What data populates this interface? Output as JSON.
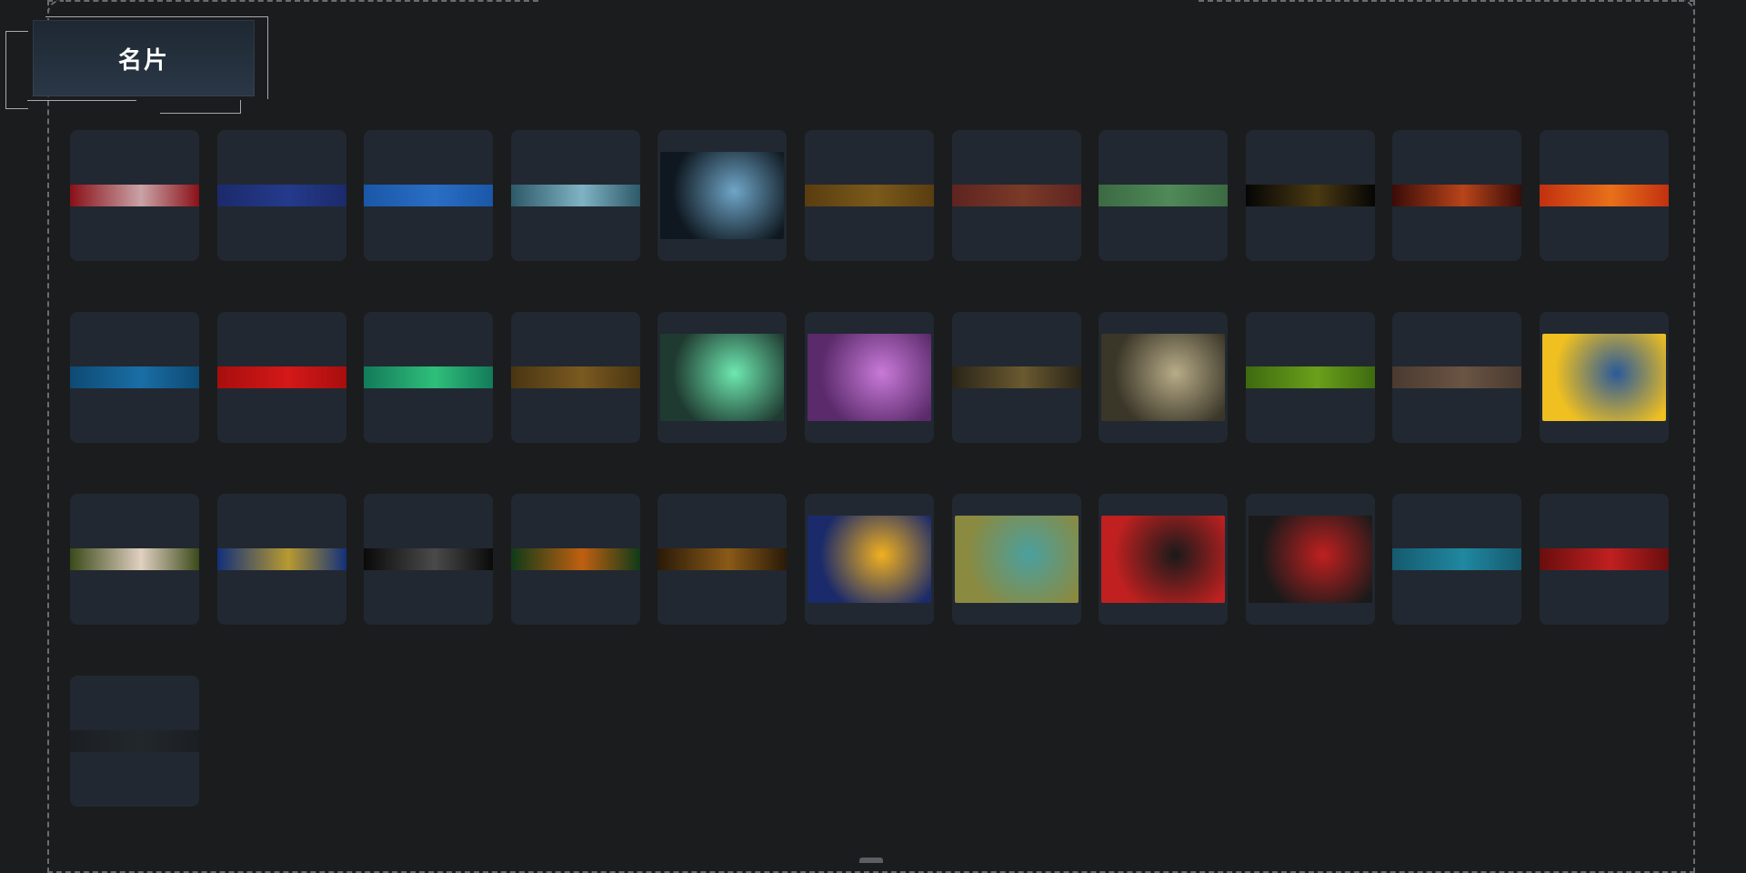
{
  "title": "名片",
  "cards": [
    {
      "kind": "strip",
      "color": "#8a1018",
      "color2": "#c9a3a6"
    },
    {
      "kind": "strip",
      "color": "#1c2a6b",
      "color2": "#243a8c"
    },
    {
      "kind": "strip",
      "color": "#1a57a8",
      "color2": "#2a6ec4"
    },
    {
      "kind": "strip",
      "color": "#2d5968",
      "color2": "#7fb3c4"
    },
    {
      "kind": "image",
      "color": "#0f1820",
      "color2": "#6fa6c8",
      "icon": "car-image"
    },
    {
      "kind": "strip",
      "color": "#5a3d10",
      "color2": "#7a5a1a"
    },
    {
      "kind": "strip",
      "color": "#5e2420",
      "color2": "#7a3a28"
    },
    {
      "kind": "strip",
      "color": "#3b6a42",
      "color2": "#4f8a58"
    },
    {
      "kind": "strip",
      "color": "#050505",
      "color2": "#4a3a12"
    },
    {
      "kind": "strip",
      "color": "#3a0c08",
      "color2": "#b8441a"
    },
    {
      "kind": "strip",
      "color": "#c23010",
      "color2": "#e8701a"
    },
    {
      "kind": "strip",
      "color": "#0e4a73",
      "color2": "#1a6ea6"
    },
    {
      "kind": "strip",
      "color": "#a80e0e",
      "color2": "#d41818"
    },
    {
      "kind": "strip",
      "color": "#137a5a",
      "color2": "#2fbf7a"
    },
    {
      "kind": "strip",
      "color": "#4a3512",
      "color2": "#7a5a20"
    },
    {
      "kind": "image",
      "color": "#1f3a30",
      "color2": "#6ee8b0",
      "icon": "zombie-hands-image"
    },
    {
      "kind": "image",
      "color": "#5a2a6a",
      "color2": "#c87ad8",
      "icon": "purple-hair-face-image"
    },
    {
      "kind": "strip",
      "color": "#2a2418",
      "color2": "#6a5a30"
    },
    {
      "kind": "image",
      "color": "#3a3628",
      "color2": "#b8ac88",
      "icon": "winner-chicken-dinner-image"
    },
    {
      "kind": "strip",
      "color": "#3e6a10",
      "color2": "#6aa01a"
    },
    {
      "kind": "strip",
      "color": "#4a3a30",
      "color2": "#6a5444"
    },
    {
      "kind": "image",
      "color": "#f0c020",
      "color2": "#2a5a9a",
      "icon": "comic-woman-image"
    },
    {
      "kind": "strip",
      "color": "#3a4a1a",
      "color2": "#e0d0c0"
    },
    {
      "kind": "strip",
      "color": "#12307a",
      "color2": "#b89a30"
    },
    {
      "kind": "strip",
      "color": "#0a0a0a",
      "color2": "#4a4a4a"
    },
    {
      "kind": "strip",
      "color": "#0f3a18",
      "color2": "#c06010"
    },
    {
      "kind": "strip",
      "color": "#2a1a08",
      "color2": "#8a5a18"
    },
    {
      "kind": "image",
      "color": "#1a2a6a",
      "color2": "#f0b020",
      "icon": "gold-eight-image"
    },
    {
      "kind": "image",
      "color": "#8a8a40",
      "color2": "#4aa0a0",
      "icon": "frog-knight-image"
    },
    {
      "kind": "image",
      "color": "#c02020",
      "color2": "#1a1a1a",
      "icon": "black-wolves-image"
    },
    {
      "kind": "image",
      "color": "#1a1a1a",
      "color2": "#c02020",
      "icon": "good-luck-wolf-image"
    },
    {
      "kind": "strip",
      "color": "#155a6e",
      "color2": "#2088a0"
    },
    {
      "kind": "strip",
      "color": "#6a0e0e",
      "color2": "#c02020"
    },
    {
      "kind": "strip",
      "color": "#1b1f23",
      "color2": "#22272c"
    }
  ]
}
